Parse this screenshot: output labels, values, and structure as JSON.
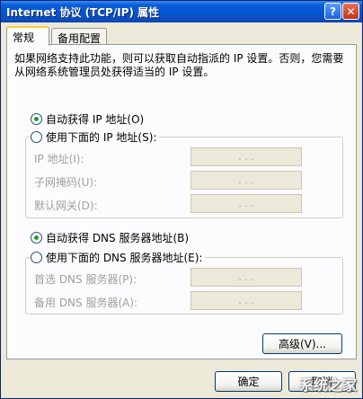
{
  "window": {
    "title": "Internet 协议 (TCP/IP) 属性",
    "help_label": "?",
    "close_label": "✕"
  },
  "tabs": [
    {
      "label": "常规",
      "active": true
    },
    {
      "label": "备用配置",
      "active": false
    }
  ],
  "description": "如果网络支持此功能，则可以获取自动指派的 IP 设置。否则，您需要从网络系统管理员处获得适当的 IP 设置。",
  "ip_section": {
    "auto_label": "自动获得 IP 地址(O)",
    "manual_label": "使用下面的 IP 地址(S):",
    "selected": "auto",
    "fields": [
      {
        "label": "IP 地址(I):",
        "value": ". . ."
      },
      {
        "label": "子网掩码(U):",
        "value": ". . ."
      },
      {
        "label": "默认网关(D):",
        "value": ". . ."
      }
    ]
  },
  "dns_section": {
    "auto_label": "自动获得 DNS 服务器地址(B)",
    "manual_label": "使用下面的 DNS 服务器地址(E):",
    "selected": "auto",
    "fields": [
      {
        "label": "首选 DNS 服务器(P):",
        "value": ". . ."
      },
      {
        "label": "备用 DNS 服务器(A):",
        "value": ". . ."
      }
    ]
  },
  "buttons": {
    "advanced": "高级(V)...",
    "ok": "确定",
    "cancel": "取消"
  },
  "watermark": "系统之家"
}
